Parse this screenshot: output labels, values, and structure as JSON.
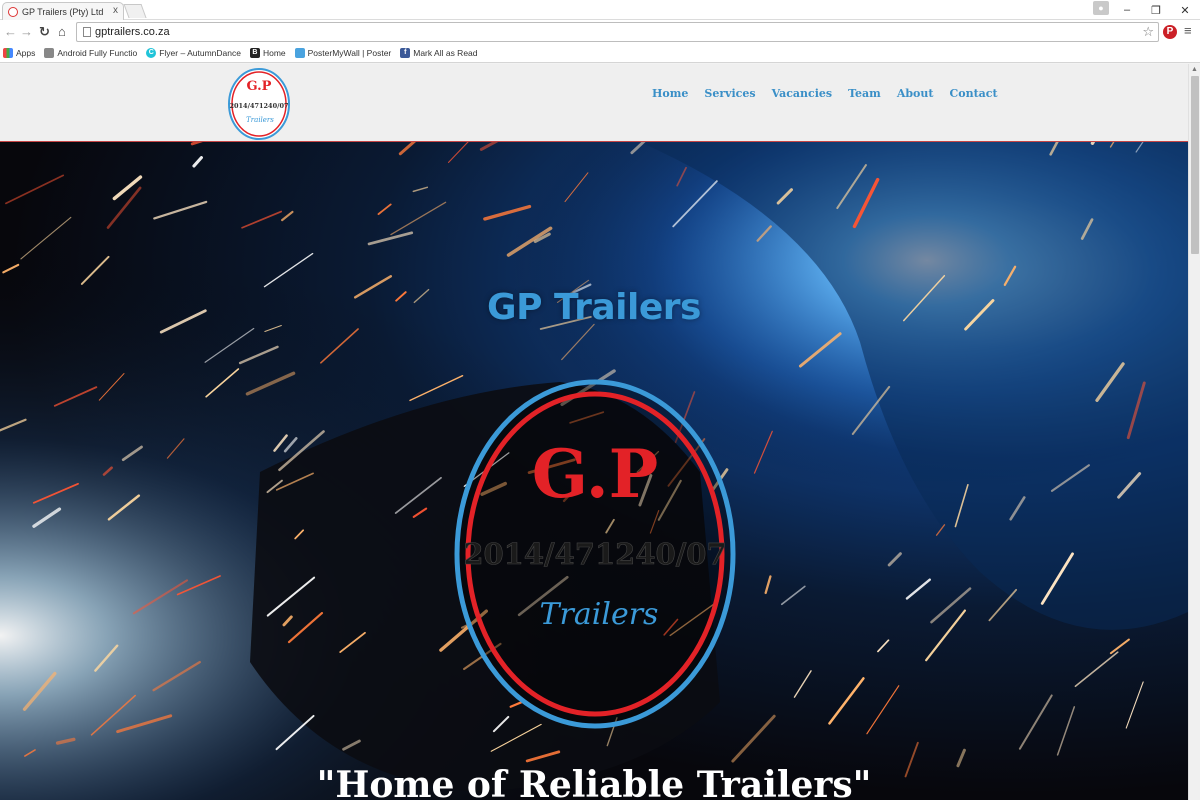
{
  "browser": {
    "tab_title": "GP Trailers (Pty) Ltd",
    "tab_close": "x",
    "url": "gptrailers.co.za",
    "bookmarks": [
      {
        "label": "Apps",
        "icon": "apps-grid-icon",
        "color": "#d44"
      },
      {
        "label": "Android Fully Functio",
        "icon": "android-icon",
        "color": "#777"
      },
      {
        "label": "Flyer – AutumnDance",
        "icon": "canva-icon",
        "color": "#21c4d9"
      },
      {
        "label": "Home",
        "icon": "b-icon",
        "color": "#222"
      },
      {
        "label": "PosterMyWall | Poster",
        "icon": "postermywall-icon",
        "color": "#4aa3df"
      },
      {
        "label": "Mark All as Read",
        "icon": "facebook-icon",
        "color": "#3b5998"
      }
    ]
  },
  "site": {
    "logo": {
      "initials": "G.P",
      "registration": "2014/471240/07",
      "word": "Trailers"
    },
    "nav": [
      "Home",
      "Services",
      "Vacancies",
      "Team",
      "About",
      "Contact"
    ],
    "hero_title": "GP Trailers",
    "tagline": "\"Home of Reliable Trailers\""
  },
  "colors": {
    "brand_blue": "#3b9ad8",
    "brand_red": "#e32227",
    "nav_blue": "#3a8fc7"
  }
}
